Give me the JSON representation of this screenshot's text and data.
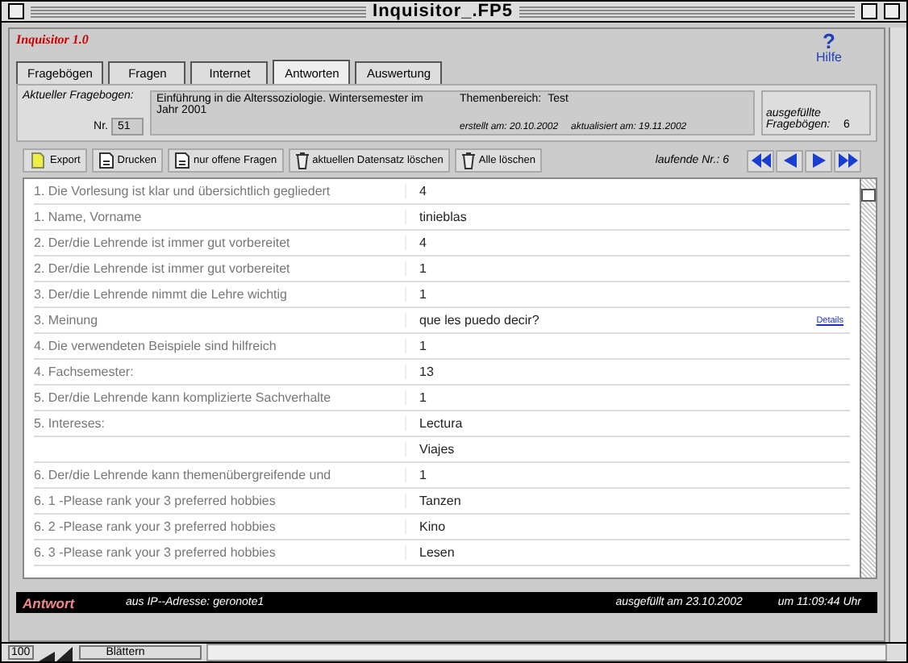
{
  "window": {
    "title": "Inquisitor_.FP5"
  },
  "app_title": "Inquisitor 1.0",
  "help": {
    "label": "Hilfe",
    "icon_glyph": "?"
  },
  "tabs": [
    {
      "label": "Fragebögen",
      "selected": false
    },
    {
      "label": "Fragen",
      "selected": false
    },
    {
      "label": "Internet",
      "selected": false
    },
    {
      "label": "Antworten",
      "selected": true
    },
    {
      "label": "Auswertung",
      "selected": false
    }
  ],
  "current": {
    "label": "Aktueller Fragebogen:",
    "nr_label": "Nr.",
    "nr": "51",
    "title": "Einführung in die Alterssoziologie. Wintersemester im Jahr 2001",
    "topic_label": "Themenbereich:",
    "topic": "Test",
    "created": "erstellt am: 20.10.2002",
    "updated": "aktualisiert am: 19.11.2002",
    "filled_label": "ausgefüllte Fragebögen:",
    "filled": "6"
  },
  "toolbar": [
    {
      "label": "Export"
    },
    {
      "label": "Drucken"
    },
    {
      "label": "nur offene Fragen"
    },
    {
      "label": "aktuellen Datensatz löschen"
    },
    {
      "label": "Alle löschen"
    }
  ],
  "record": "laufende Nr.: 6",
  "rows": [
    {
      "question": "1. Die Vorlesung ist klar und übersichtlich gegliedert",
      "answer": "4"
    },
    {
      "question": "1. Name, Vorname",
      "answer": "tinieblas"
    },
    {
      "question": "2. Der/die Lehrende ist immer gut vorbereitet",
      "answer": "4"
    },
    {
      "question": "2. Der/die Lehrende ist immer gut vorbereitet",
      "answer": "1"
    },
    {
      "question": "3. Der/die Lehrende nimmt die Lehre wichtig",
      "answer": "1"
    },
    {
      "question": "3. Meinung",
      "answer": "que les puedo decir?",
      "link": "Details"
    },
    {
      "question": "4. Die verwendeten Beispiele sind hilfreich",
      "answer": "1"
    },
    {
      "question": "4. Fachsemester:",
      "answer": "13"
    },
    {
      "question": "5. Der/die Lehrende kann komplizierte Sachverhalte",
      "answer": "1"
    },
    {
      "question": "5. Intereses:",
      "answer": "Lectura"
    },
    {
      "answer": "Viajes"
    },
    {
      "question": "6. Der/die Lehrende kann themenübergreifende und",
      "answer": "1"
    },
    {
      "question": "6. 1 -Please rank your 3 preferred hobbies",
      "answer": "Tanzen"
    },
    {
      "question": "6. 2 -Please rank your 3 preferred hobbies",
      "answer": "Kino"
    },
    {
      "question": "6. 3 -Please rank your 3 preferred hobbies",
      "answer": "Lesen"
    }
  ],
  "footer": {
    "label": "Antwort",
    "ip": "aus IP--Adresse: geronote1",
    "filled": "ausgefüllt am  23.10.2002",
    "time": "um  11:09:44 Uhr"
  },
  "status_bar": {
    "zoom": "100",
    "mode": "Blättern"
  }
}
